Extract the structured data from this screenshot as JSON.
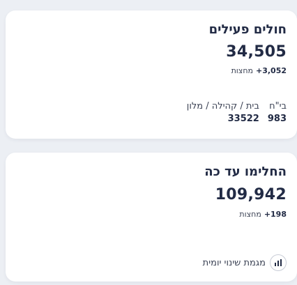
{
  "active_patients": {
    "title": "חולים פעילים",
    "total": "34,505",
    "delta_value": "+3,052",
    "delta_label": "מחצות",
    "breakdown": [
      {
        "label": "בי\"ח",
        "value": "983"
      },
      {
        "label": "בית / קהילה / מלון",
        "value": "33522"
      }
    ]
  },
  "recovered": {
    "title": "החלימו עד כה",
    "total": "109,942",
    "delta_value": "+198",
    "delta_label": "מחצות",
    "chart_link_label": "מגמת שינוי יומית",
    "chart_icon": "bar-chart-icon"
  },
  "colors": {
    "background": "#eceff4",
    "card": "#ffffff",
    "text_primary": "#222b45",
    "text_secondary": "#3b4254"
  }
}
